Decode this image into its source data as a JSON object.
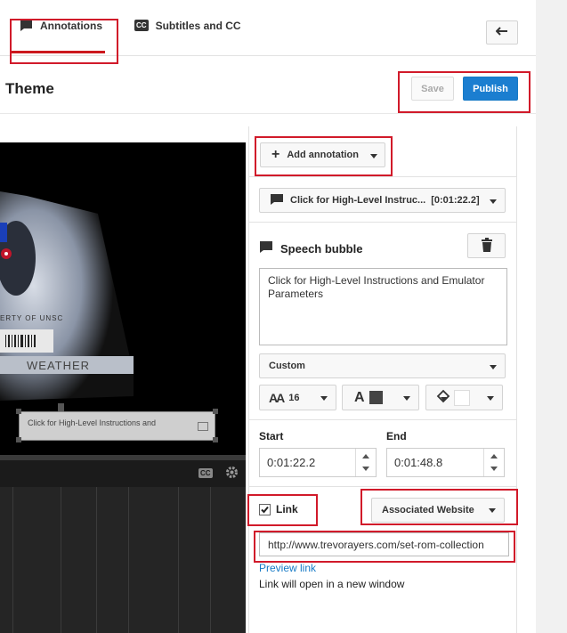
{
  "tabs": {
    "annotations": "Annotations",
    "subtitles": "Subtitles and CC",
    "cc_badge": "CC"
  },
  "header": {
    "title": "Theme",
    "save_label": "Save",
    "publish_label": "Publish"
  },
  "video": {
    "label_weather": "WEATHER",
    "label_university": "ERTY OF UNSC",
    "overlay_text": "Click for High-Level Instructions and",
    "cc_badge": "CC"
  },
  "editor": {
    "add_annotation_label": "Add annotation",
    "annotation_select": "Click for High-Level Instruc...",
    "annotation_time": "[0:01:22.2]",
    "type_title": "Speech bubble",
    "text": "Click for High-Level Instructions and Emulator Parameters",
    "font_style": "Custom",
    "font_size": "16",
    "start_label": "Start",
    "end_label": "End",
    "start_value": "0:01:22.2",
    "end_value": "0:01:48.8",
    "link_label": "Link",
    "link_checked": true,
    "link_type": "Associated Website",
    "url": "http://www.trevorayers.com/set-rom-collection",
    "preview_link": "Preview link",
    "new_window_note": "Link will open in a new window"
  },
  "colors": {
    "publish": "#1b7ed0",
    "highlight": "#d11a2a",
    "tab_underline": "#cc181e",
    "link": "#167ac6",
    "text_color_swatch": "#444444",
    "bg_color_swatch": "#ffffff"
  }
}
